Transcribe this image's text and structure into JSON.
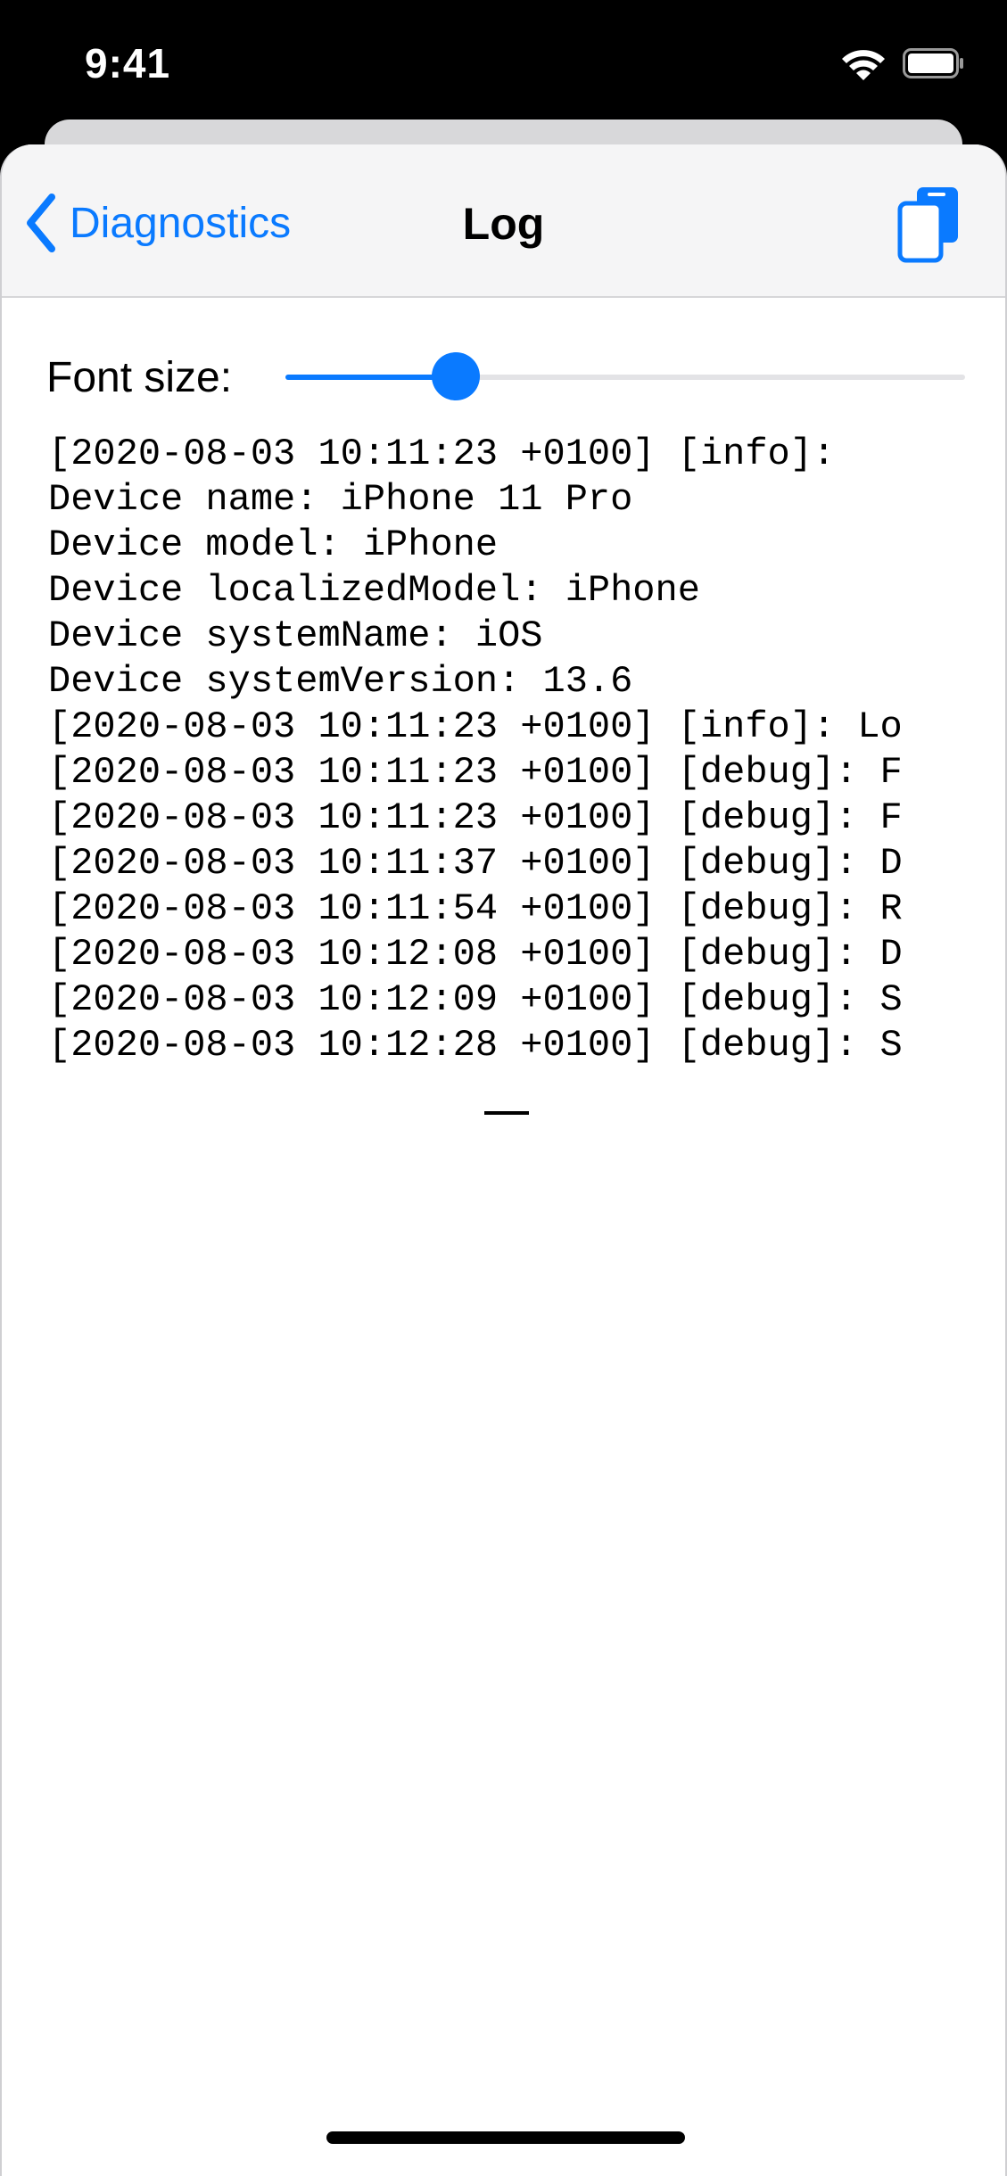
{
  "status_bar": {
    "time": "9:41",
    "wifi_icon": "wifi-icon",
    "battery_icon": "battery-icon"
  },
  "nav": {
    "back_label": "Diagnostics",
    "back_icon": "chevron-left-icon",
    "title": "Log",
    "action_icon": "copy-icon"
  },
  "controls": {
    "font_size_label": "Font size:",
    "font_size_value": 0.25
  },
  "log": {
    "lines": [
      "[2020-08-03 10:11:23 +0100] [info]:",
      "Device name: iPhone 11 Pro",
      "Device model: iPhone",
      "Device localizedModel: iPhone",
      "Device systemName: iOS",
      "Device systemVersion: 13.6",
      "[2020-08-03 10:11:23 +0100] [info]: Lo",
      "[2020-08-03 10:11:23 +0100] [debug]: F",
      "[2020-08-03 10:11:23 +0100] [debug]: F",
      "[2020-08-03 10:11:37 +0100] [debug]: D",
      "[2020-08-03 10:11:54 +0100] [debug]: R",
      "[2020-08-03 10:12:08 +0100] [debug]: D",
      "[2020-08-03 10:12:09 +0100] [debug]: S",
      "[2020-08-03 10:12:28 +0100] [debug]: S"
    ]
  },
  "colors": {
    "accent": "#0a7aff",
    "nav_background": "#f5f5f6",
    "status_background": "#000000"
  }
}
